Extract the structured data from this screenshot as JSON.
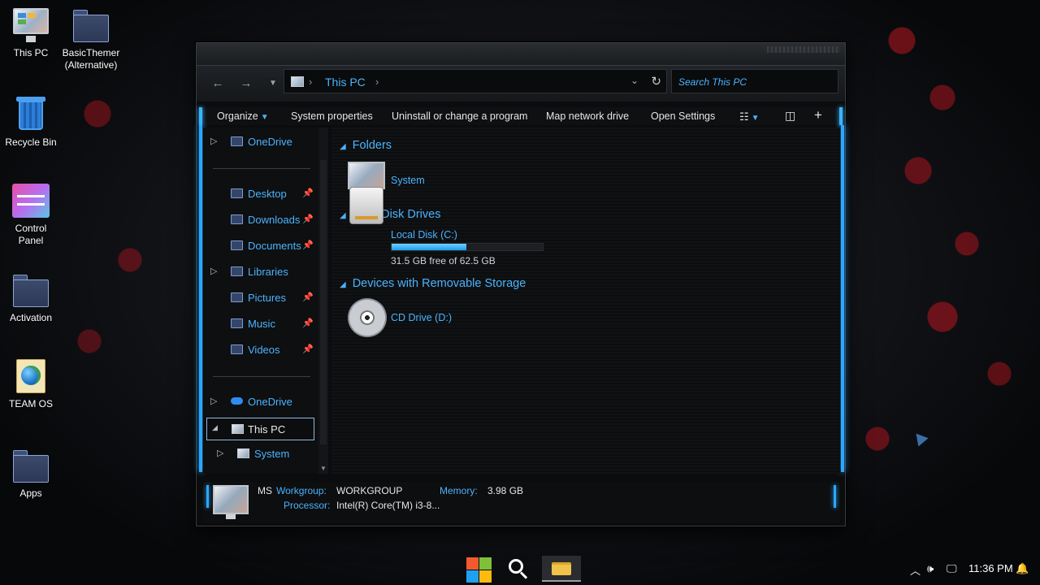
{
  "desktop": {
    "icons": [
      {
        "label": "This PC",
        "icon": "pc-icon"
      },
      {
        "label": "BasicThemer (Alternative)",
        "icon": "folder-icon"
      },
      {
        "label": "Recycle Bin",
        "icon": "recycle-bin-icon"
      },
      {
        "label": "Control Panel",
        "icon": "control-panel-icon"
      },
      {
        "label": "Activation",
        "icon": "folder-icon"
      },
      {
        "label": "TEAM OS",
        "icon": "team-os-icon"
      },
      {
        "label": "Apps",
        "icon": "folder-icon"
      }
    ]
  },
  "explorer": {
    "address": {
      "crumb": "This PC",
      "sep1": "›",
      "sep2": "›"
    },
    "search": {
      "placeholder": "Search This PC"
    },
    "commands": {
      "organize": "Organize",
      "system_properties": "System properties",
      "uninstall": "Uninstall or change a program",
      "map_drive": "Map network drive",
      "open_settings": "Open Settings"
    },
    "nav": {
      "onedrive_top": "OneDrive",
      "desktop": "Desktop",
      "downloads": "Downloads",
      "documents": "Documents",
      "libraries": "Libraries",
      "pictures": "Pictures",
      "music": "Music",
      "videos": "Videos",
      "onedrive": "OneDrive",
      "this_pc": "This PC",
      "system": "System"
    },
    "groups": {
      "folders": "Folders",
      "hard_disk_drives": "Hard Disk Drives",
      "removable": "Devices with Removable Storage"
    },
    "items": {
      "system": "System",
      "local_disk": "Local Disk (C:)",
      "local_disk_free": "31.5 GB free of 62.5 GB",
      "local_disk_used_fraction": 0.496,
      "cd_drive": "CD Drive (D:)"
    },
    "details": {
      "name": "MS",
      "workgroup_key": "Workgroup:",
      "workgroup_val": "WORKGROUP",
      "memory_key": "Memory:",
      "memory_val": "3.98 GB",
      "processor_key": "Processor:",
      "processor_val": "Intel(R) Core(TM) i3-8..."
    }
  },
  "taskbar": {
    "clock": "11:36 PM",
    "tray_icons": [
      "chevron-up-icon",
      "volume-icon",
      "network-icon",
      "notification-icon"
    ]
  },
  "colors": {
    "accent": "#4ab3ff",
    "edge_glow": "#2aa8ff"
  }
}
